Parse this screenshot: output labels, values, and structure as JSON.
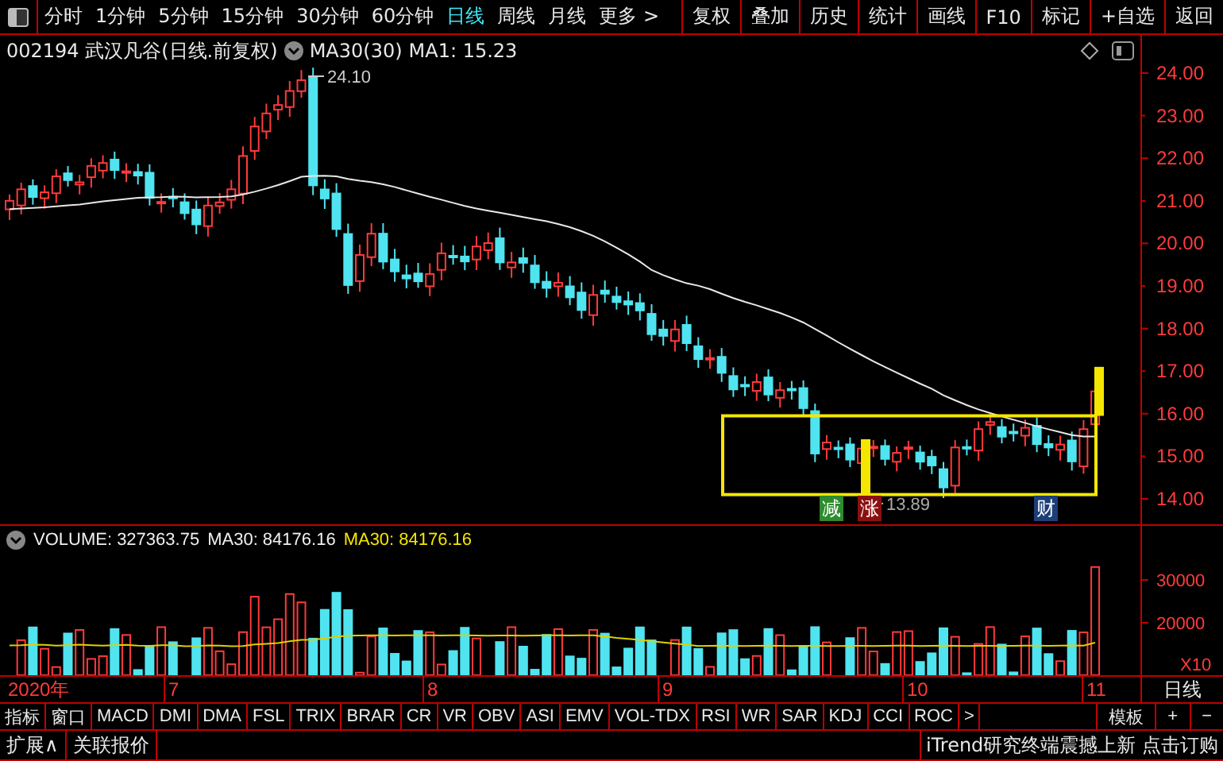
{
  "toolbar": {
    "items": [
      {
        "label": "分时",
        "selected": false
      },
      {
        "label": "1分钟",
        "selected": false
      },
      {
        "label": "5分钟",
        "selected": false
      },
      {
        "label": "15分钟",
        "selected": false
      },
      {
        "label": "30分钟",
        "selected": false
      },
      {
        "label": "60分钟",
        "selected": false
      },
      {
        "label": "日线",
        "selected": true
      },
      {
        "label": "周线",
        "selected": false
      },
      {
        "label": "月线",
        "selected": false
      },
      {
        "label": "更多 >",
        "selected": false
      }
    ],
    "buttons": [
      "复权",
      "叠加",
      "历史",
      "统计",
      "画线",
      "F10",
      "标记",
      "+自选",
      "返回"
    ]
  },
  "header": {
    "title": "002194 武汉凡谷(日线.前复权)",
    "indicator": "MA30(30)",
    "ma_value": "MA1: 15.23"
  },
  "price_axis": {
    "ticks": [
      "24.00",
      "23.00",
      "22.00",
      "21.00",
      "20.00",
      "19.00",
      "18.00",
      "17.00",
      "16.00",
      "15.00",
      "14.00"
    ]
  },
  "annotations": {
    "high": "24.10",
    "low": "13.89",
    "badges": [
      {
        "label": "减",
        "color": "#2e8b2e"
      },
      {
        "label": "涨",
        "color": "#8b1010"
      },
      {
        "label": "财",
        "color": "#1c3f78"
      }
    ]
  },
  "volume": {
    "label": "VOLUME: 327363.75",
    "ma": "MA30: 84176.16",
    "ma_yellow": "MA30: 84176.16",
    "ticks": [
      "30000",
      "20000"
    ],
    "unit": "X10"
  },
  "date_axis": {
    "labels": [
      "2020年",
      "7",
      "8",
      "9",
      "10",
      "11"
    ],
    "period": "日线"
  },
  "indicator_tabs": [
    "指标",
    "窗口",
    "MACD",
    "DMI",
    "DMA",
    "FSL",
    "TRIX",
    "BRAR",
    "CR",
    "VR",
    "OBV",
    "ASI",
    "EMV",
    "VOL-TDX",
    "RSI",
    "WR",
    "SAR",
    "KDJ",
    "CCI",
    "ROC",
    ">"
  ],
  "indicator_tools": [
    "模板",
    "+",
    "−"
  ],
  "status_bar": {
    "left": [
      "扩展∧",
      "关联报价"
    ],
    "right": "iTrend研究终端震撼上新 点击订购"
  }
}
